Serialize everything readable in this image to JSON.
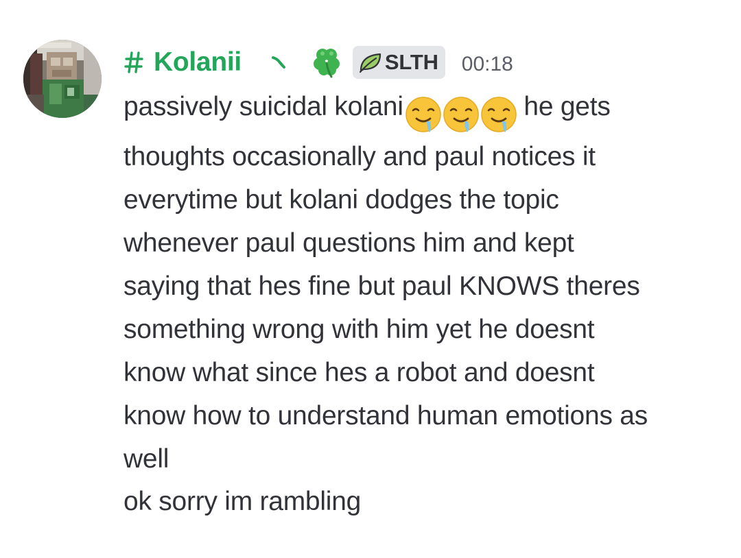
{
  "message": {
    "author": {
      "username": "Kolanii",
      "username_color": "#23a55a",
      "avatar_alt": "user-avatar",
      "icons": [
        "hashtag-icon",
        "decoration-icon",
        "four-leaf-clover-icon"
      ]
    },
    "clan_tag": {
      "icon": "leaf-icon",
      "label": "SLTH"
    },
    "timestamp": "00:18",
    "body": {
      "line1_prefix": "passively suicidal kolani",
      "emoji_name": "drooling-face-emoji",
      "emoji_count": 3,
      "line1_suffix": " he gets",
      "lines": [
        "thoughts occasionally and paul notices it",
        "everytime but kolani dodges the topic",
        "whenever paul questions him and kept",
        "saying that hes fine but paul KNOWS theres",
        "something wrong with him yet he doesnt",
        "know what since hes a robot and doesnt",
        "know how to understand human emotions as",
        "well"
      ]
    },
    "followup": "ok sorry im rambling"
  },
  "colors": {
    "text": "#313338",
    "timestamp": "#5c5e66",
    "clan_tag_bg": "#e3e5e8",
    "background": "#ffffff"
  }
}
